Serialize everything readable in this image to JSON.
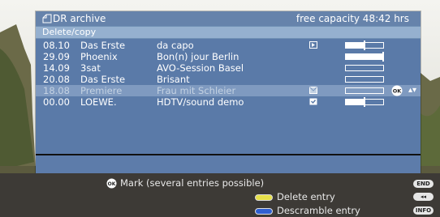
{
  "header": {
    "title": "DR archive",
    "capacity": "free capacity 48:42 hrs"
  },
  "subheader": {
    "label": "Delete/copy"
  },
  "recordings": [
    {
      "date": "08.10",
      "channel": "Das Erste",
      "title": "da capo",
      "status_icon": "play-triangle-icon",
      "progress": 0.5,
      "selected": false
    },
    {
      "date": "29.09",
      "channel": "Phoenix",
      "title": "Bon(n) jour Berlin",
      "status_icon": "",
      "progress": 1.0,
      "selected": false
    },
    {
      "date": "14.09",
      "channel": "3sat",
      "title": "AVO-Session Basel",
      "status_icon": "",
      "progress": 0.0,
      "selected": false
    },
    {
      "date": "20.08",
      "channel": "Das Erste",
      "title": "Brisant",
      "status_icon": "",
      "progress": 0.0,
      "selected": false
    },
    {
      "date": "18.08",
      "channel": "Premiere",
      "title": "Frau mit Schleier",
      "status_icon": "envelope-icon",
      "progress": 0.0,
      "selected": true
    },
    {
      "date": "00.00",
      "channel": "LOEWE.",
      "title": "HDTV/sound demo",
      "status_icon": "lock-icon",
      "progress": 0.5,
      "selected": false
    }
  ],
  "help": {
    "mark": "Mark (several entries possible)",
    "delete": "Delete entry",
    "descramble": "Descramble entry",
    "keys": {
      "end": "END",
      "rewind": "◂◂",
      "info": "INFO"
    }
  },
  "colors": {
    "panel": "#6f8fb4",
    "title_bar": "#6683ab",
    "subtitle_bar": "#95b0cf",
    "selected_row": "#7f9ac0",
    "yellow_button": "#e6e04a",
    "blue_button": "#2f5fd0"
  }
}
